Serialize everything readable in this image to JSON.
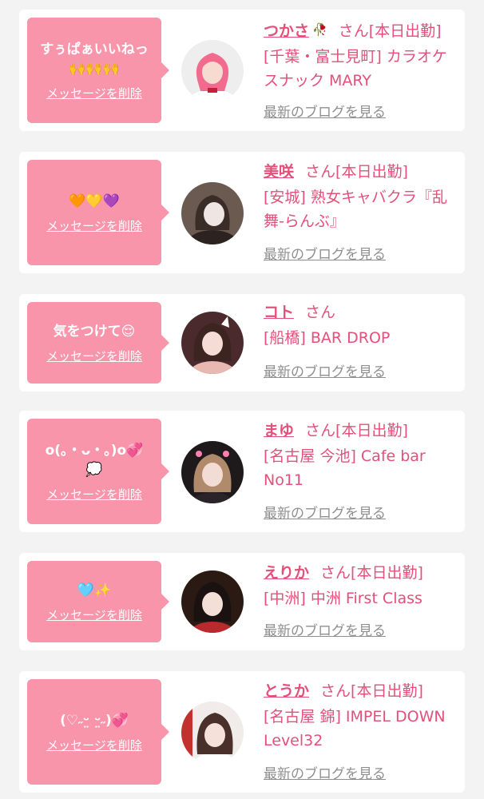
{
  "delete_label": "メッセージを削除",
  "blog_label": "最新のブログを見る",
  "honorific": "さん",
  "colors": {
    "accent": "#e3507a",
    "bubble": "#f995ab",
    "link_gray": "#8f8f8f",
    "background": "#f3f3f3"
  },
  "entries": [
    {
      "message": "すぅぱぁいいねっ",
      "message_line2": "🙌🙌🙌",
      "name": "つかさ",
      "name_sticker": "🥀",
      "status": "[本日出勤]",
      "shop": "[千葉・富士見町] カラオケスナック MARY",
      "avatar_icon": "portrait-pink-hair-icon"
    },
    {
      "message": "🧡💛💜",
      "message_line2": "",
      "name": "美咲",
      "name_sticker": "",
      "status": "[本日出勤]",
      "shop": "[安城] 熟女キャバクラ『乱舞-らんぶ』",
      "avatar_icon": "portrait-icon"
    },
    {
      "message": "気をつけて😌",
      "message_line2": "",
      "name": "コト",
      "name_sticker": "",
      "status": "",
      "shop": "[船橋] BAR DROP",
      "avatar_icon": "portrait-icon"
    },
    {
      "message": "o(｡・ᴗ・｡)o💞",
      "message_line2": "💭",
      "name": "まゆ",
      "name_sticker": "",
      "status": "[本日出勤]",
      "shop": "[名古屋 今池] Cafe bar No11",
      "avatar_icon": "portrait-icon"
    },
    {
      "message": "🩵✨",
      "message_line2": "",
      "name": "えりか",
      "name_sticker": "",
      "status": "[本日出勤]",
      "shop": "[中洲] 中洲 First Class",
      "avatar_icon": "portrait-icon"
    },
    {
      "message": "(♡˶ᵕ̤ ᵕ̤˶)💞",
      "message_line2": "",
      "name": "とうか",
      "name_sticker": "",
      "status": "[本日出勤]",
      "shop": "[名古屋 錦] IMPEL DOWN Level32",
      "avatar_icon": "portrait-icon"
    }
  ]
}
